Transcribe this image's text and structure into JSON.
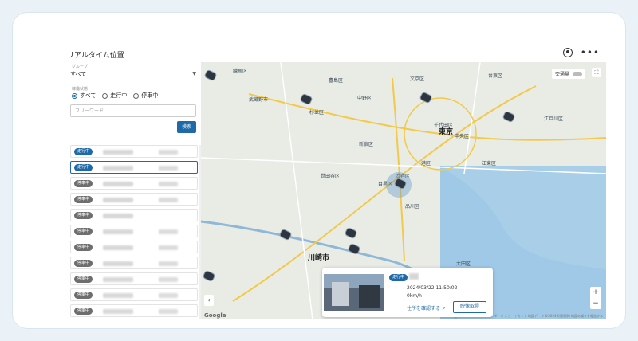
{
  "page": {
    "title": "リアルタイム位置"
  },
  "sidebar": {
    "group_label": "グループ",
    "group_value": "すべて",
    "status_label": "稼働状態",
    "status_options": [
      {
        "label": "すべて",
        "selected": true
      },
      {
        "label": "走行中",
        "selected": false
      },
      {
        "label": "停車中",
        "selected": false
      }
    ],
    "freeword_placeholder": "フリーワード",
    "search_label": "検索",
    "vehicles": [
      {
        "status": "走行中",
        "kind": "run",
        "selected": false
      },
      {
        "status": "走行中",
        "kind": "run",
        "selected": true
      },
      {
        "status": "停車中",
        "kind": "stop",
        "selected": false
      },
      {
        "status": "停車中",
        "kind": "stop",
        "selected": false
      },
      {
        "status": "停車中",
        "kind": "stop",
        "selected": false,
        "dash": "-"
      },
      {
        "status": "停車中",
        "kind": "stop",
        "selected": false
      },
      {
        "status": "停車中",
        "kind": "stop",
        "selected": false
      },
      {
        "status": "停車中",
        "kind": "stop",
        "selected": false
      },
      {
        "status": "停車中",
        "kind": "stop",
        "selected": false
      },
      {
        "status": "停車中",
        "kind": "stop",
        "selected": false
      },
      {
        "status": "停車中",
        "kind": "stop",
        "selected": false
      }
    ]
  },
  "map": {
    "traffic_label": "交通量",
    "labels": [
      "練馬区",
      "文京区",
      "台東区",
      "豊島区",
      "中野区",
      "杉並区",
      "新宿区",
      "千代田区",
      "東京",
      "中央区",
      "江戸川区",
      "渋谷区",
      "港区",
      "江東区",
      "世田谷区",
      "目黒区",
      "品川区",
      "大田区",
      "川崎市",
      "武蔵野市"
    ],
    "attribution": "キーボード ショートカット  地図データ ©2024  利用規約  地図の誤りを報告する",
    "google": "Google",
    "zoom_in": "+",
    "zoom_out": "−",
    "back": "‹"
  },
  "popup": {
    "status": "走行中",
    "datetime": "2024/03/22 11:50:02",
    "speed": "0km/h",
    "address_link": "住所を確認する",
    "capture_button": "映像取得"
  }
}
